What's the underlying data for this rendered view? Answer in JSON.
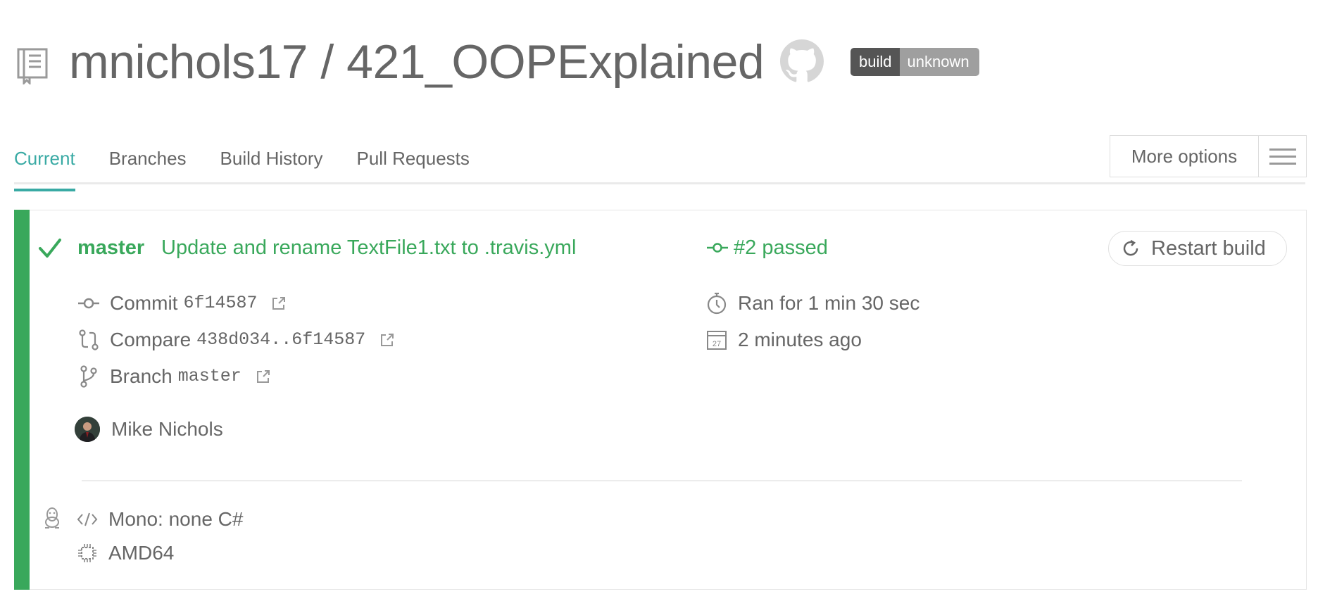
{
  "header": {
    "title": "mnichols17 / 421_OOPExplained",
    "badge_left": "build",
    "badge_right": "unknown"
  },
  "tabs": [
    {
      "label": "Current",
      "active": true
    },
    {
      "label": "Branches",
      "active": false
    },
    {
      "label": "Build History",
      "active": false
    },
    {
      "label": "Pull Requests",
      "active": false
    }
  ],
  "more_options": {
    "label": "More options",
    "icon": "hamburger-icon"
  },
  "build": {
    "branch": "master",
    "message": "Update and rename TextFile1.txt to .travis.yml",
    "status": "#2 passed",
    "restart_label": "Restart build",
    "commit_label": "Commit",
    "commit_sha": "6f14587",
    "compare_label": "Compare",
    "compare_range": "438d034..6f14587",
    "branch_label": "Branch",
    "branch_value": "master",
    "duration": "Ran for 1 min 30 sec",
    "finished": "2 minutes ago",
    "calendar_day": "27",
    "author": "Mike Nichols",
    "language": "Mono: none C#",
    "arch": "AMD64"
  },
  "colors": {
    "passed": "#39a85b",
    "tab_active": "#39aaa4",
    "text": "#666666"
  }
}
